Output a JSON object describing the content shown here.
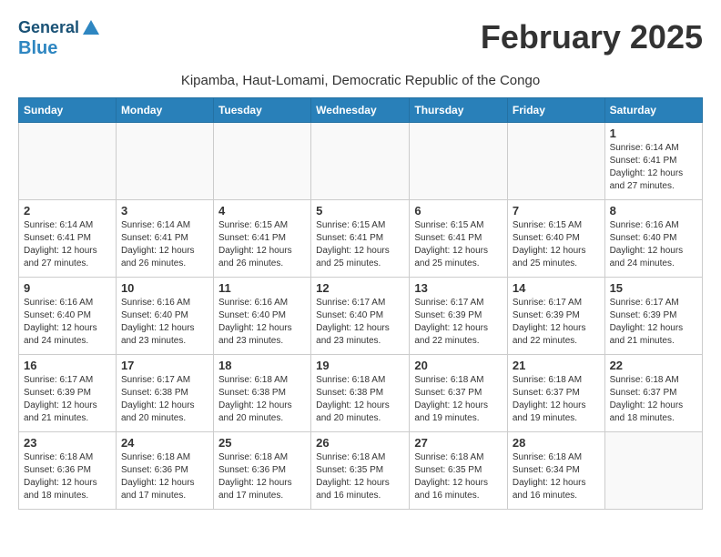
{
  "header": {
    "logo_line1": "General",
    "logo_line2": "Blue",
    "month_year": "February 2025",
    "location": "Kipamba, Haut-Lomami, Democratic Republic of the Congo"
  },
  "weekdays": [
    "Sunday",
    "Monday",
    "Tuesday",
    "Wednesday",
    "Thursday",
    "Friday",
    "Saturday"
  ],
  "weeks": [
    [
      {
        "day": "",
        "info": ""
      },
      {
        "day": "",
        "info": ""
      },
      {
        "day": "",
        "info": ""
      },
      {
        "day": "",
        "info": ""
      },
      {
        "day": "",
        "info": ""
      },
      {
        "day": "",
        "info": ""
      },
      {
        "day": "1",
        "info": "Sunrise: 6:14 AM\nSunset: 6:41 PM\nDaylight: 12 hours and 27 minutes."
      }
    ],
    [
      {
        "day": "2",
        "info": "Sunrise: 6:14 AM\nSunset: 6:41 PM\nDaylight: 12 hours and 27 minutes."
      },
      {
        "day": "3",
        "info": "Sunrise: 6:14 AM\nSunset: 6:41 PM\nDaylight: 12 hours and 26 minutes."
      },
      {
        "day": "4",
        "info": "Sunrise: 6:15 AM\nSunset: 6:41 PM\nDaylight: 12 hours and 26 minutes."
      },
      {
        "day": "5",
        "info": "Sunrise: 6:15 AM\nSunset: 6:41 PM\nDaylight: 12 hours and 25 minutes."
      },
      {
        "day": "6",
        "info": "Sunrise: 6:15 AM\nSunset: 6:41 PM\nDaylight: 12 hours and 25 minutes."
      },
      {
        "day": "7",
        "info": "Sunrise: 6:15 AM\nSunset: 6:40 PM\nDaylight: 12 hours and 25 minutes."
      },
      {
        "day": "8",
        "info": "Sunrise: 6:16 AM\nSunset: 6:40 PM\nDaylight: 12 hours and 24 minutes."
      }
    ],
    [
      {
        "day": "9",
        "info": "Sunrise: 6:16 AM\nSunset: 6:40 PM\nDaylight: 12 hours and 24 minutes."
      },
      {
        "day": "10",
        "info": "Sunrise: 6:16 AM\nSunset: 6:40 PM\nDaylight: 12 hours and 23 minutes."
      },
      {
        "day": "11",
        "info": "Sunrise: 6:16 AM\nSunset: 6:40 PM\nDaylight: 12 hours and 23 minutes."
      },
      {
        "day": "12",
        "info": "Sunrise: 6:17 AM\nSunset: 6:40 PM\nDaylight: 12 hours and 23 minutes."
      },
      {
        "day": "13",
        "info": "Sunrise: 6:17 AM\nSunset: 6:39 PM\nDaylight: 12 hours and 22 minutes."
      },
      {
        "day": "14",
        "info": "Sunrise: 6:17 AM\nSunset: 6:39 PM\nDaylight: 12 hours and 22 minutes."
      },
      {
        "day": "15",
        "info": "Sunrise: 6:17 AM\nSunset: 6:39 PM\nDaylight: 12 hours and 21 minutes."
      }
    ],
    [
      {
        "day": "16",
        "info": "Sunrise: 6:17 AM\nSunset: 6:39 PM\nDaylight: 12 hours and 21 minutes."
      },
      {
        "day": "17",
        "info": "Sunrise: 6:17 AM\nSunset: 6:38 PM\nDaylight: 12 hours and 20 minutes."
      },
      {
        "day": "18",
        "info": "Sunrise: 6:18 AM\nSunset: 6:38 PM\nDaylight: 12 hours and 20 minutes."
      },
      {
        "day": "19",
        "info": "Sunrise: 6:18 AM\nSunset: 6:38 PM\nDaylight: 12 hours and 20 minutes."
      },
      {
        "day": "20",
        "info": "Sunrise: 6:18 AM\nSunset: 6:37 PM\nDaylight: 12 hours and 19 minutes."
      },
      {
        "day": "21",
        "info": "Sunrise: 6:18 AM\nSunset: 6:37 PM\nDaylight: 12 hours and 19 minutes."
      },
      {
        "day": "22",
        "info": "Sunrise: 6:18 AM\nSunset: 6:37 PM\nDaylight: 12 hours and 18 minutes."
      }
    ],
    [
      {
        "day": "23",
        "info": "Sunrise: 6:18 AM\nSunset: 6:36 PM\nDaylight: 12 hours and 18 minutes."
      },
      {
        "day": "24",
        "info": "Sunrise: 6:18 AM\nSunset: 6:36 PM\nDaylight: 12 hours and 17 minutes."
      },
      {
        "day": "25",
        "info": "Sunrise: 6:18 AM\nSunset: 6:36 PM\nDaylight: 12 hours and 17 minutes."
      },
      {
        "day": "26",
        "info": "Sunrise: 6:18 AM\nSunset: 6:35 PM\nDaylight: 12 hours and 16 minutes."
      },
      {
        "day": "27",
        "info": "Sunrise: 6:18 AM\nSunset: 6:35 PM\nDaylight: 12 hours and 16 minutes."
      },
      {
        "day": "28",
        "info": "Sunrise: 6:18 AM\nSunset: 6:34 PM\nDaylight: 12 hours and 16 minutes."
      },
      {
        "day": "",
        "info": ""
      }
    ]
  ]
}
